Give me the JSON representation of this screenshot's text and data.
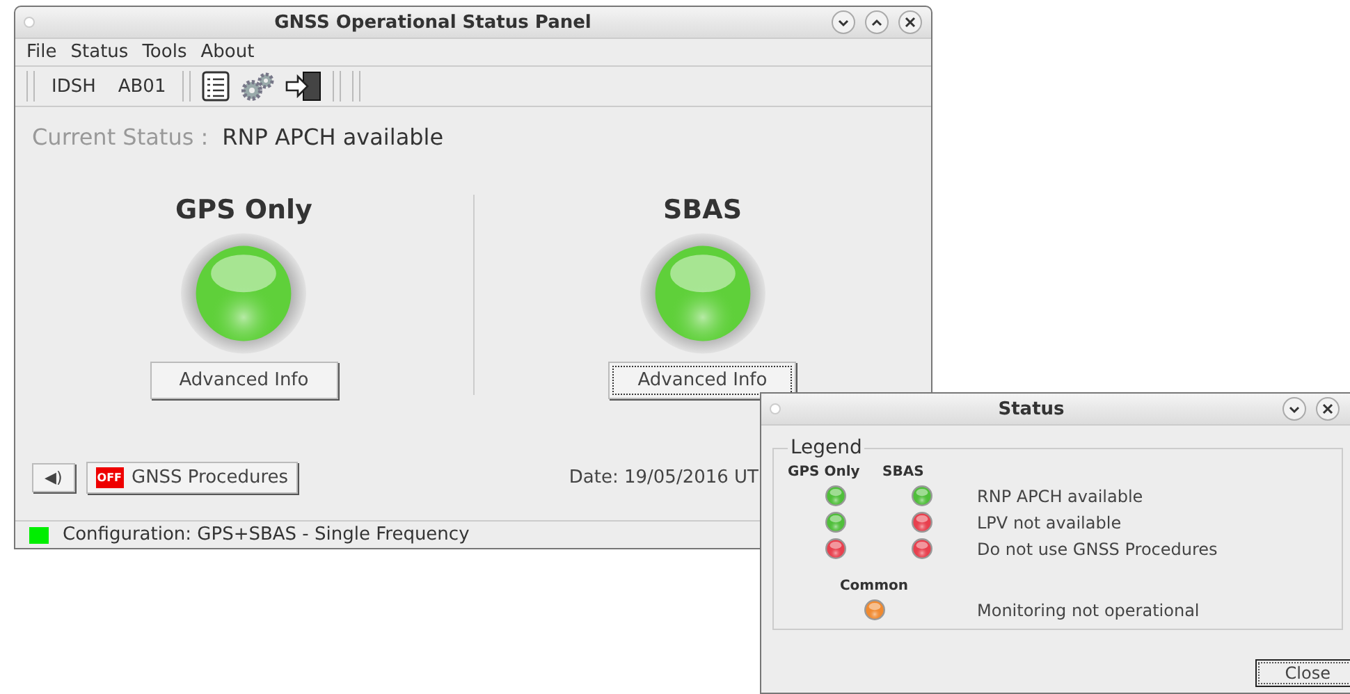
{
  "main_window": {
    "title": "GNSS Operational Status Panel",
    "menu": [
      "File",
      "Status",
      "Tools",
      "About"
    ],
    "toolbar": {
      "labels": [
        "IDSH",
        "AB01"
      ]
    },
    "current_status": {
      "label": "Current Status :",
      "value": "RNP APCH available"
    },
    "panels": [
      {
        "title": "GPS Only",
        "led": {
          "color": "#5fd03a"
        },
        "button": "Advanced Info",
        "focused": false
      },
      {
        "title": "SBAS",
        "led": {
          "color": "#5fd03a"
        },
        "button": "Advanced Info",
        "focused": true
      }
    ],
    "sound_button": "◀)",
    "procedures_button": {
      "badge": "OFF",
      "label": "GNSS Procedures"
    },
    "date": "Date: 19/05/2016  UT",
    "status_bar": {
      "color": "#00ee00",
      "text": "Configuration: GPS+SBAS - Single Frequency"
    }
  },
  "status_dialog": {
    "title": "Status",
    "legend": {
      "title": "Legend",
      "columns": [
        "GPS Only",
        "SBAS"
      ],
      "rows": [
        {
          "gps": {
            "color": "#4fbf3a"
          },
          "sbas": {
            "color": "#4fbf3a"
          },
          "label": "RNP APCH available"
        },
        {
          "gps": {
            "color": "#4fbf3a"
          },
          "sbas": {
            "color": "#e8404e"
          },
          "label": "LPV not available"
        },
        {
          "gps": {
            "color": "#e8404e"
          },
          "sbas": {
            "color": "#e8404e"
          },
          "label": "Do not use GNSS Procedures"
        }
      ],
      "common": {
        "title": "Common",
        "color": "#f08a30",
        "label": "Monitoring not operational"
      }
    },
    "close_button": "Close"
  }
}
